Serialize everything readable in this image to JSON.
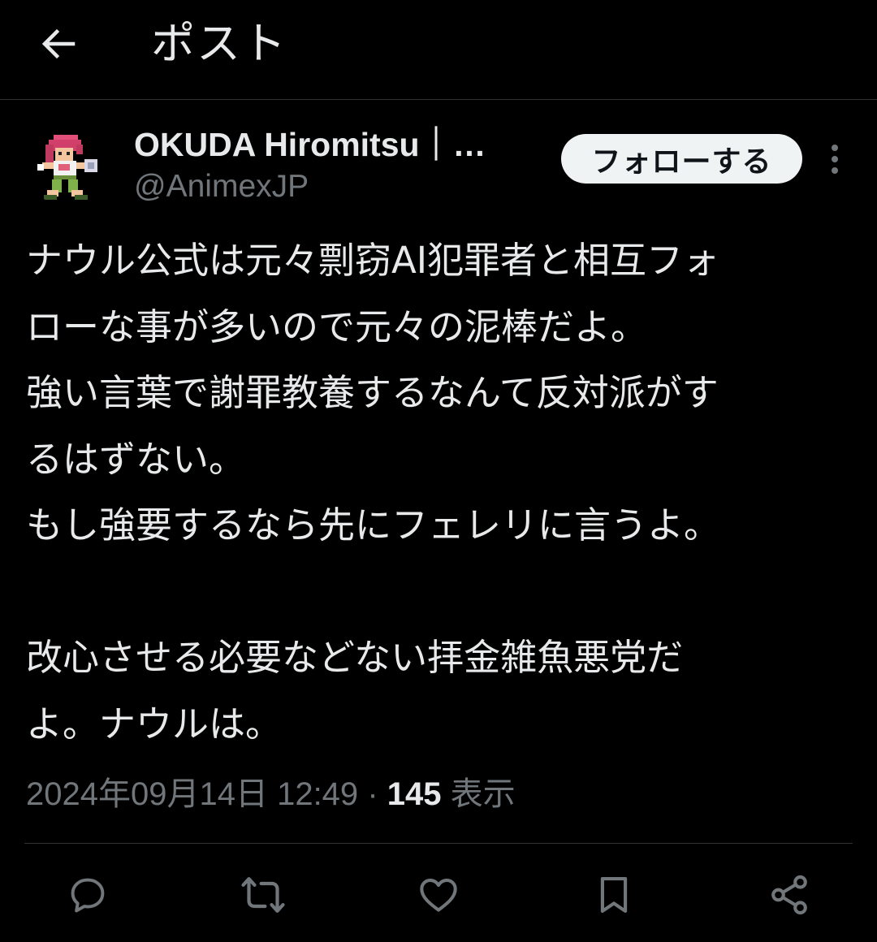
{
  "header": {
    "title": "ポスト",
    "back_icon": "arrow-left-icon"
  },
  "author": {
    "display_name": "OKUDA Hiromitsu｜…",
    "handle": "@AnimexJP",
    "avatar": "pixel-art-character-avatar"
  },
  "follow_button": {
    "label": "フォローする"
  },
  "more_icon": "more-vertical-icon",
  "tweet": {
    "lines": [
      "ナウル公式は元々剽窃AI犯罪者と相互フォ",
      "ローな事が多いので元々の泥棒だよ。",
      "強い言葉で謝罪教養するなんて反対派がす",
      "るはずない。",
      "もし強要するなら先にフェレリに言うよ。",
      "",
      "改心させる必要などない拝金雑魚悪党だ",
      "よ。ナウルは。"
    ]
  },
  "meta": {
    "timestamp": "2024年09月14日 12:49",
    "separator": "·",
    "view_count": "145",
    "view_label": "表示"
  },
  "actions": [
    {
      "name": "reply-button",
      "icon": "comment-icon"
    },
    {
      "name": "repost-button",
      "icon": "repost-icon"
    },
    {
      "name": "like-button",
      "icon": "heart-icon"
    },
    {
      "name": "bookmark-button",
      "icon": "bookmark-icon"
    },
    {
      "name": "share-button",
      "icon": "share-icon"
    }
  ],
  "colors": {
    "background": "#000000",
    "text_primary": "#e7e9ea",
    "text_secondary": "#71767b",
    "divider": "#2f3336",
    "follow_bg": "#eff3f4"
  }
}
